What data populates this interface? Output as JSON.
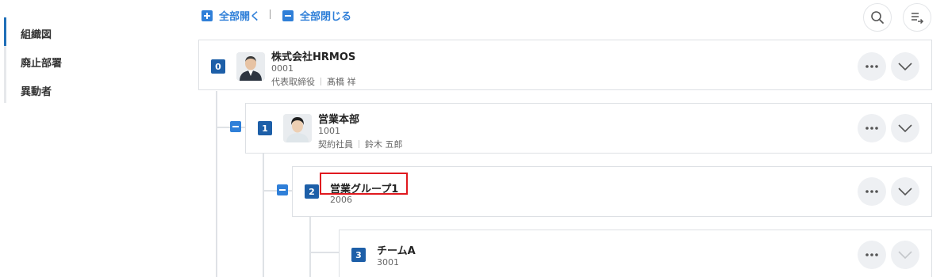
{
  "sidebar": {
    "items": [
      {
        "label": "組織図",
        "active": true
      },
      {
        "label": "廃止部署",
        "active": false
      },
      {
        "label": "異動者",
        "active": false
      }
    ]
  },
  "toolbar": {
    "expand_all": "全部開く",
    "separator": "|",
    "collapse_all": "全部閉じる",
    "search_icon": "search-icon",
    "sort_icon": "list-arrow-icon"
  },
  "tree": {
    "nodes": [
      {
        "level": "0",
        "name": "株式会社HRMOS",
        "code": "0001",
        "role": "代表取締役",
        "person": "髙橋 祥",
        "avatar": "man-in-suit-photo"
      },
      {
        "level": "1",
        "name": "営業本部",
        "code": "1001",
        "role": "契約社員",
        "person": "鈴木 五郎",
        "avatar": "young-man-photo"
      },
      {
        "level": "2",
        "name": "営業グループ1",
        "code": "2006",
        "highlighted": true
      },
      {
        "level": "3",
        "name": "チームA",
        "code": "3001"
      }
    ]
  },
  "colors": {
    "accent": "#2f7fd8",
    "badge": "#1d5fa8",
    "highlight": "#e0191f"
  }
}
